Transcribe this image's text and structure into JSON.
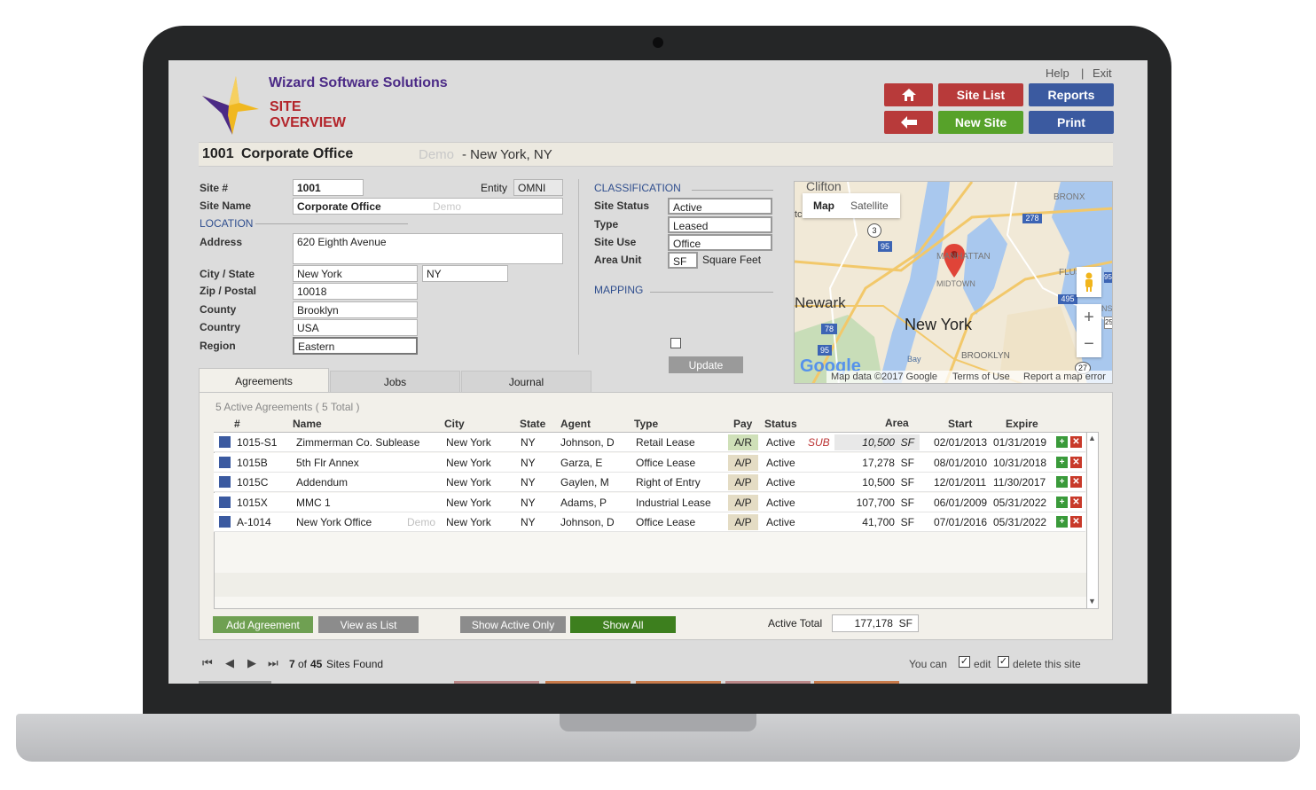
{
  "company": "Wizard Software Solutions",
  "page_title_1": "SITE",
  "page_title_2": "OVERVIEW",
  "top_links": {
    "help": "Help",
    "sep": "|",
    "exit": "Exit"
  },
  "nav": {
    "site_list": "Site List",
    "reports": "Reports",
    "new_site": "New Site",
    "print": "Print",
    "home_icon": "home-icon",
    "back_icon": "arrow-left-icon"
  },
  "header": {
    "site_no": "1001",
    "site_name": "Corporate Office",
    "demo": "Demo",
    "location": "- New York, NY"
  },
  "form": {
    "site_no_label": "Site #",
    "site_no": "1001",
    "entity_label": "Entity",
    "entity": "OMNI",
    "site_name_label": "Site Name",
    "site_name": "Corporate Office",
    "site_name_demo": "Demo",
    "location_label": "LOCATION",
    "address_label": "Address",
    "address": "620 Eighth Avenue",
    "city_state_label": "City / State",
    "city": "New York",
    "state": "NY",
    "zip_label": "Zip / Postal",
    "zip": "10018",
    "county_label": "County",
    "county": "Brooklyn",
    "country_label": "Country",
    "country": "USA",
    "region_label": "Region",
    "region": "Eastern"
  },
  "classification": {
    "title": "CLASSIFICATION",
    "status_label": "Site Status",
    "status": "Active",
    "type_label": "Type",
    "type": "Leased",
    "use_label": "Site Use",
    "use": "Office",
    "area_unit_label": "Area Unit",
    "area_unit": "SF",
    "area_unit_desc": "Square Feet",
    "mapping": "MAPPING",
    "update": "Update"
  },
  "map": {
    "btn_map": "Map",
    "btn_satellite": "Satellite",
    "clifton": "Clifton",
    "bronx": "BRONX",
    "manhattan": "MANHATTAN",
    "midtown": "MIDTOWN",
    "flushing": "FLUSH",
    "newark": "Newark",
    "new_york": "New York",
    "brooklyn": "BROOKLYN",
    "tc": "tc",
    "ns": "NS",
    "bay": "Bay",
    "google": "Google",
    "footer_data": "Map data ©2017 Google",
    "footer_terms": "Terms of Use",
    "footer_report": "Report a map error",
    "zoom_in": "+",
    "zoom_out": "−",
    "shields": [
      "278",
      "95",
      "278",
      "495",
      "78",
      "95",
      "3",
      "27",
      "95",
      "25"
    ]
  },
  "tabs": [
    "Agreements",
    "Jobs",
    "Journal"
  ],
  "agreements": {
    "summary": "5 Active Agreements ( 5 Total )",
    "columns": [
      "#",
      "Name",
      "City",
      "State",
      "Agent",
      "Type",
      "Pay",
      "Status",
      "Area",
      "Start",
      "Expire"
    ],
    "rows": [
      {
        "id": "1015-S1",
        "name": "Zimmerman Co. Sublease",
        "demo": "",
        "city": "New York",
        "state": "NY",
        "agent": "Johnson, D",
        "type": "Retail Lease",
        "pay": "A/R",
        "status": "Active",
        "sub": "SUB",
        "area": "10,500",
        "unit": "SF",
        "start": "02/01/2013",
        "expire": "01/31/2019"
      },
      {
        "id": "1015B",
        "name": "5th Flr Annex",
        "demo": "",
        "city": "New York",
        "state": "NY",
        "agent": "Garza, E",
        "type": "Office Lease",
        "pay": "A/P",
        "status": "Active",
        "sub": "",
        "area": "17,278",
        "unit": "SF",
        "start": "08/01/2010",
        "expire": "10/31/2018"
      },
      {
        "id": "1015C",
        "name": "Addendum",
        "demo": "",
        "city": "New York",
        "state": "NY",
        "agent": "Gaylen, M",
        "type": "Right of Entry",
        "pay": "A/P",
        "status": "Active",
        "sub": "",
        "area": "10,500",
        "unit": "SF",
        "start": "12/01/2011",
        "expire": "11/30/2017"
      },
      {
        "id": "1015X",
        "name": "MMC 1",
        "demo": "",
        "city": "New York",
        "state": "NY",
        "agent": "Adams, P",
        "type": "Industrial Lease",
        "pay": "A/P",
        "status": "Active",
        "sub": "",
        "area": "107,700",
        "unit": "SF",
        "start": "06/01/2009",
        "expire": "05/31/2022"
      },
      {
        "id": "A-1014",
        "name": "New York Office",
        "demo": "Demo",
        "city": "New York",
        "state": "NY",
        "agent": "Johnson, D",
        "type": "Office Lease",
        "pay": "A/P",
        "status": "Active",
        "sub": "",
        "area": "41,700",
        "unit": "SF",
        "start": "07/01/2016",
        "expire": "05/31/2022"
      }
    ],
    "add": "Add Agreement",
    "view_list": "View as List",
    "show_active": "Show Active Only",
    "show_all": "Show All",
    "active_total_label": "Active Total",
    "active_total": "177,178",
    "active_total_unit": "SF"
  },
  "footer": {
    "record": "7",
    "of": "of",
    "count": "45",
    "sites_found": "Sites Found",
    "you_can": "You can",
    "edit": "edit",
    "delete": "delete this site"
  },
  "colors": {
    "brand_purple": "#4b2a86",
    "title_red": "#b3242a",
    "btn_red": "#b83a3a",
    "btn_green": "#57a22a",
    "btn_navy": "#3b5aa0",
    "row_marker": "#3b5aa0"
  }
}
